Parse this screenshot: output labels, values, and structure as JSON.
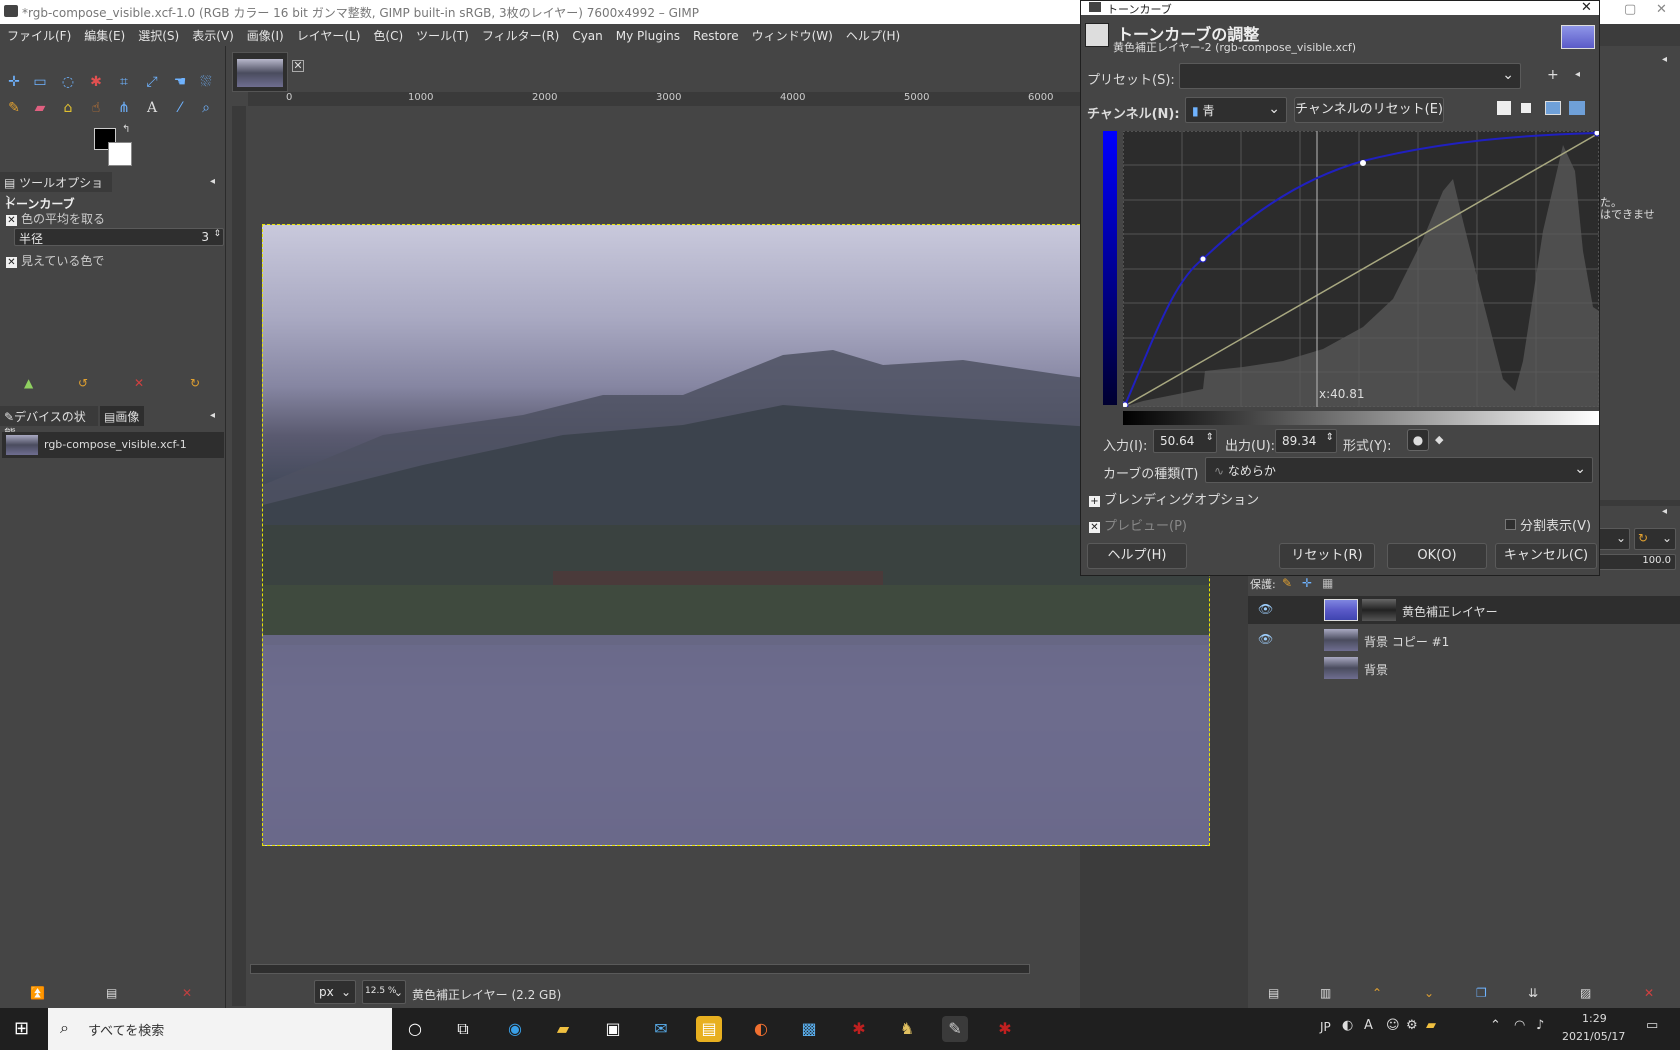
{
  "window": {
    "title": "*rgb-compose_visible.xcf-1.0 (RGB カラー 16 bit ガンマ整数, GIMP built-in sRGB, 3枚のレイヤー) 7600x4992 – GIMP"
  },
  "menu": [
    "ファイル(F)",
    "編集(E)",
    "選択(S)",
    "表示(V)",
    "画像(I)",
    "レイヤー(L)",
    "色(C)",
    "ツール(T)",
    "フィルター(R)",
    "Cyan",
    "My Plugins",
    "Restore",
    "ウィンドウ(W)",
    "ヘルプ(H)"
  ],
  "tool_options": {
    "tab": "ツールオプション",
    "tool_name": "トーンカーブ",
    "sample_average": "色の平均を取る",
    "radius_label": "半径",
    "radius_value": "3",
    "visible_color": "見えている色で"
  },
  "images_panel": {
    "tab_device": "デバイスの状態",
    "tab_image": "画像",
    "item": "rgb-compose_visible.xcf-1"
  },
  "ruler": [
    "0",
    "1000",
    "2000",
    "3000",
    "4000",
    "5000",
    "6000"
  ],
  "statusbar": {
    "unit": "px",
    "zoom": "12.5 %",
    "layer_info": "黄色補正レイヤー (2.2 GB)"
  },
  "curves_dialog": {
    "window_title": "トーンカーブ",
    "heading": "トーンカーブの調整",
    "subheading": "黄色補正レイヤー-2 (rgb-compose_visible.xcf)",
    "preset_label": "プリセット(S):",
    "preset_value": "",
    "channel_label": "チャンネル(N):",
    "channel_value": "青",
    "channel_reset": "チャンネルのリセット(E)",
    "cursor_readout": "x:40.81",
    "input_label": "入力(I):",
    "input_value": "50.64",
    "output_label": "出力(U):",
    "output_value": "89.34",
    "type_label": "形式(Y):",
    "curve_type_label": "カーブの種類(T)",
    "curve_type_value": "なめらか",
    "blending_options": "ブレンディングオプション",
    "preview": "プレビュー(P)",
    "split_view": "分割表示(V)",
    "help": "ヘルプ(H)",
    "reset": "リセット(R)",
    "ok": "OK(O)",
    "cancel": "キャンセル(C)"
  },
  "layers_panel": {
    "lock_label": "保護:",
    "opacity": "100.0",
    "layers": [
      {
        "name": "黄色補正レイヤー",
        "visible": true
      },
      {
        "name": "背景 コピー #1",
        "visible": true
      },
      {
        "name": "背景",
        "visible": false
      }
    ],
    "partial_text_1": "た。",
    "partial_text_2": "はできませ"
  },
  "taskbar": {
    "search_placeholder": "すべてを検索",
    "lang": "JP",
    "time": "1:29",
    "date": "2021/05/17"
  },
  "colors": {
    "accent_blue": "#2020c0",
    "selection_yellow": "#e6e600",
    "dialog_bg": "#454545"
  }
}
